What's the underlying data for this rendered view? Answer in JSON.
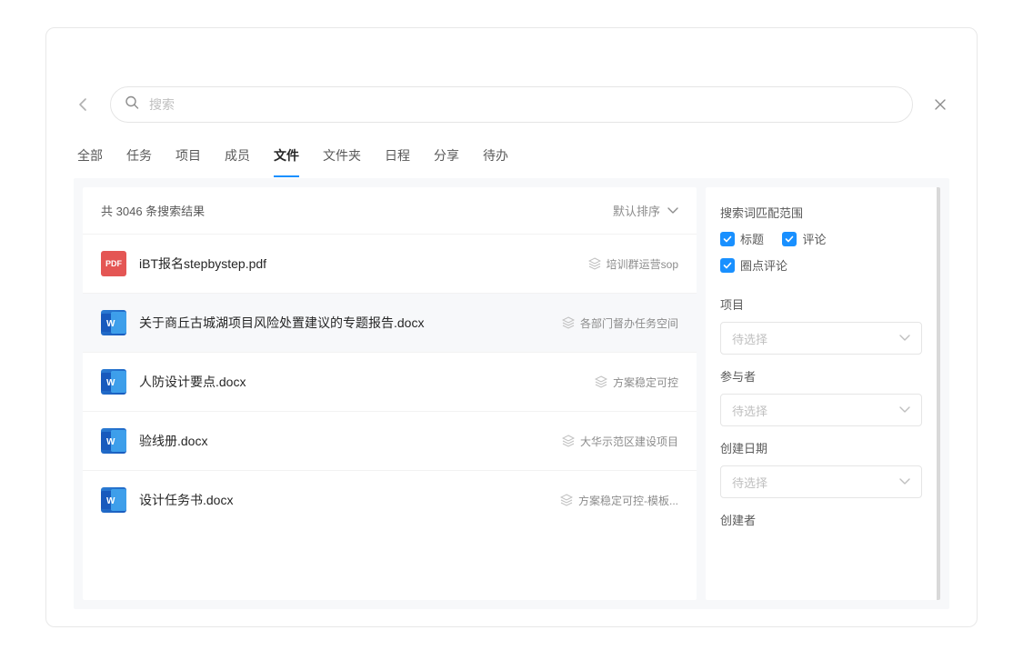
{
  "search": {
    "placeholder": "搜索",
    "value": ""
  },
  "tabs": [
    {
      "label": "全部"
    },
    {
      "label": "任务"
    },
    {
      "label": "项目"
    },
    {
      "label": "成员"
    },
    {
      "label": "文件",
      "active": true
    },
    {
      "label": "文件夹"
    },
    {
      "label": "日程"
    },
    {
      "label": "分享"
    },
    {
      "label": "待办"
    }
  ],
  "results_summary_prefix": "共 ",
  "results_count": "3046",
  "results_summary_suffix": " 条搜索结果",
  "sort_label": "默认排序",
  "files": [
    {
      "name": "iBT报名stepbystep.pdf",
      "tag": "培训群运营sop",
      "type": "pdf"
    },
    {
      "name": "关于商丘古城湖项目风险处置建议的专题报告.docx",
      "tag": "各部门督办任务空间",
      "type": "docx",
      "hovered": true
    },
    {
      "name": "人防设计要点.docx",
      "tag": "方案稳定可控",
      "type": "docx"
    },
    {
      "name": "验线册.docx",
      "tag": "大华示范区建设项目",
      "type": "docx"
    },
    {
      "name": "设计任务书.docx",
      "tag": "方案稳定可控-模板...",
      "type": "docx"
    }
  ],
  "filters": {
    "scope_title": "搜索词匹配范围",
    "checkboxes": [
      {
        "label": "标题",
        "checked": true
      },
      {
        "label": "评论",
        "checked": true
      },
      {
        "label": "圈点评论",
        "checked": true
      }
    ],
    "groups": [
      {
        "title": "项目",
        "placeholder": "待选择"
      },
      {
        "title": "参与者",
        "placeholder": "待选择"
      },
      {
        "title": "创建日期",
        "placeholder": "待选择"
      },
      {
        "title": "创建者",
        "placeholder": ""
      }
    ]
  },
  "icon_labels": {
    "pdf": "PDF"
  }
}
